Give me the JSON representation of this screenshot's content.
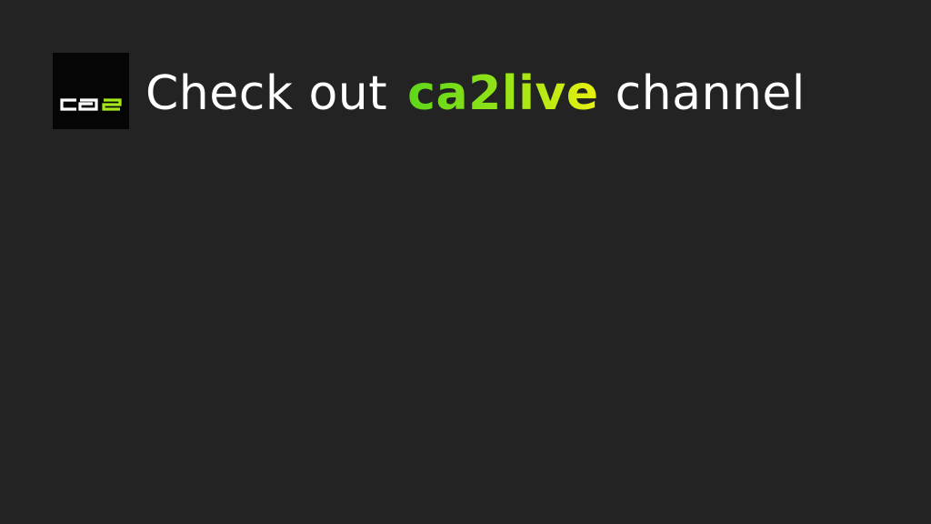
{
  "logo": {
    "text_white": "ca",
    "text_green": "2",
    "colors": {
      "background": "#050505",
      "white": "#ffffff",
      "green": "#a8e61b"
    }
  },
  "headline": {
    "prefix": "Check out",
    "brand": "ca2live",
    "suffix": "channel"
  },
  "colors": {
    "background": "#232323",
    "text": "#ffffff",
    "brand_gradient_start": "#5fd61a",
    "brand_gradient_end": "#eaf10f"
  }
}
